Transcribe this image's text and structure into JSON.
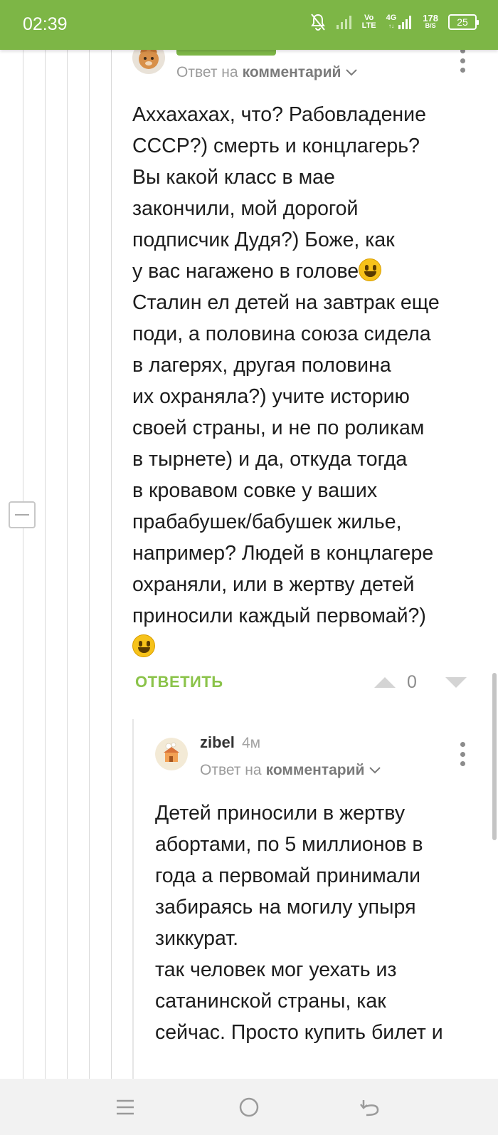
{
  "status_bar": {
    "time": "02:39",
    "volte_top": "Vo",
    "volte_bottom": "LTE",
    "network_top": "4G",
    "network_bottom": "↑↓",
    "speed_value": "178",
    "speed_unit": "B/S",
    "battery": "25",
    "icons": [
      "mute-bell-icon",
      "signal-weak-icon",
      "volte-icon",
      "4g-signal-icon",
      "network-speed-icon",
      "battery-icon"
    ]
  },
  "comment1": {
    "reply_to_label": "Ответ на",
    "reply_to_link": "комментарий",
    "body": "Аххахахах, что? Рабовладение\nСССР?) смерть и концлагерь?\nВы какой класс в мае\nзакончили, мой дорогой\nподписчик Дудя?) Боже, как\nу вас нагажено в голове",
    "body2": "Сталин ел детей на завтрак еще\nподи, а половина союза сидела\nв лагерях, другая половина\nих охраняла?) учите историю\nсвоей страны, и не по роликам\nв тырнете) и да, откуда тогда\nв кровавом совке у ваших\nпрабабушек/бабушек жилье,\nнапример? Людей в концлагере\nохраняли, или в жертву детей\nприносили каждый первомай?)",
    "reply_button": "ОТВЕТИТЬ",
    "rating": "0"
  },
  "comment2": {
    "username": "zibel",
    "time": "4м",
    "reply_to_label": "Ответ на",
    "reply_to_link": "комментарий",
    "body": "Детей приносили в жертву\nабортами, по 5 миллионов в\nгода а первомай принимали\nзабираясь на могилу упыря\nзиккурат.\nтак человек мог уехать из\nсатанинской страны, как\nсейчас. Просто купить билет и"
  },
  "colors": {
    "accent": "#7db646",
    "reply_button": "#8bc34a",
    "muted_text": "#9b9b9b"
  }
}
